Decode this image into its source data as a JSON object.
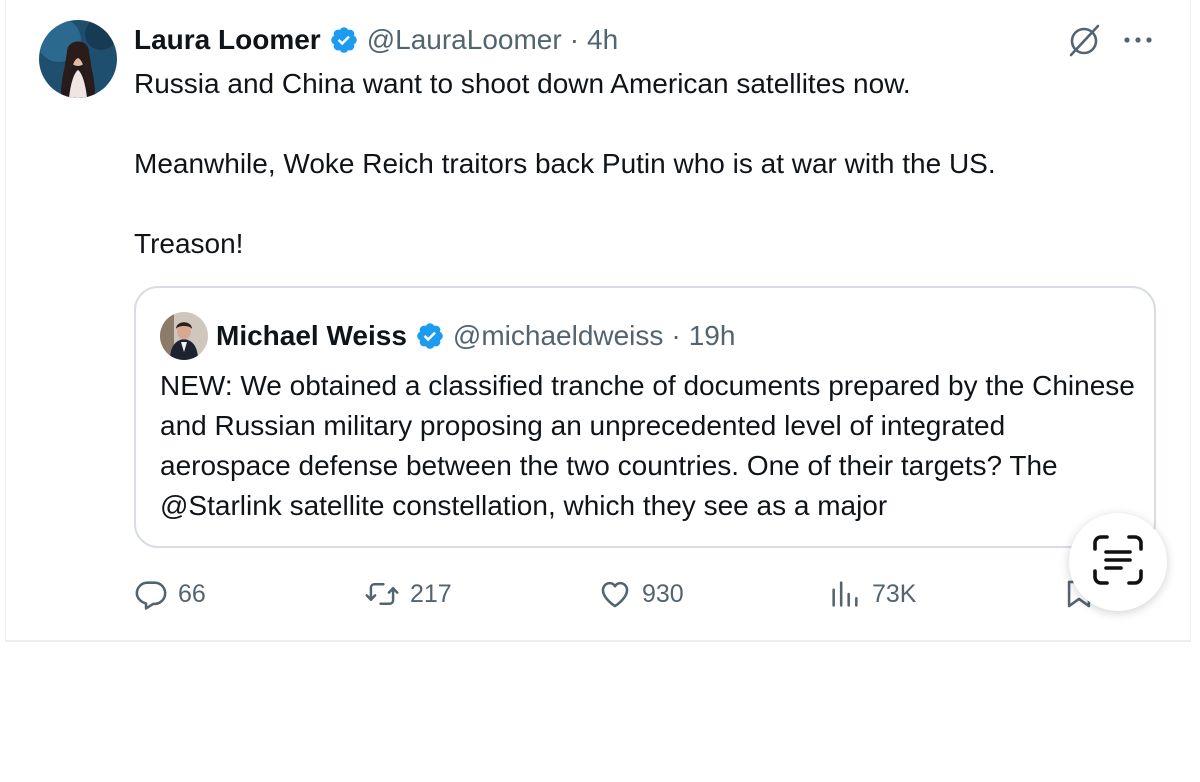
{
  "post": {
    "author_name": "Laura Loomer",
    "author_handle": "@LauraLoomer",
    "separator": "·",
    "time": "4h",
    "more_label": "···",
    "paragraphs": [
      "Russia and China want to shoot down American satellites now.",
      "Meanwhile, Woke Reich traitors back Putin who is at war with the US.",
      "Treason!"
    ]
  },
  "quote": {
    "author_name": "Michael Weiss",
    "author_handle": "@michaeldweiss",
    "separator": "·",
    "time": "19h",
    "text": "NEW: We obtained a classified tranche of documents prepared by the Chinese and Russian military proposing an unprecedented level of integrated aerospace defense between the two countries. One of their targets? The @Starlink satellite constellation, which they see as a major"
  },
  "actions": {
    "replies": "66",
    "reposts": "217",
    "likes": "930",
    "views": "73K"
  },
  "icons": {
    "verified": "verified-badge-icon",
    "grok": "grok-icon",
    "more": "more-icon",
    "reply": "reply-icon",
    "repost": "repost-icon",
    "like": "heart-icon",
    "views": "views-icon",
    "bookmark": "bookmark-icon",
    "scan": "live-text-scan-icon"
  },
  "colors": {
    "verified_blue": "#1d9bf0",
    "text_primary": "#0f1419",
    "text_secondary": "#536471",
    "border": "#d7dde2"
  }
}
